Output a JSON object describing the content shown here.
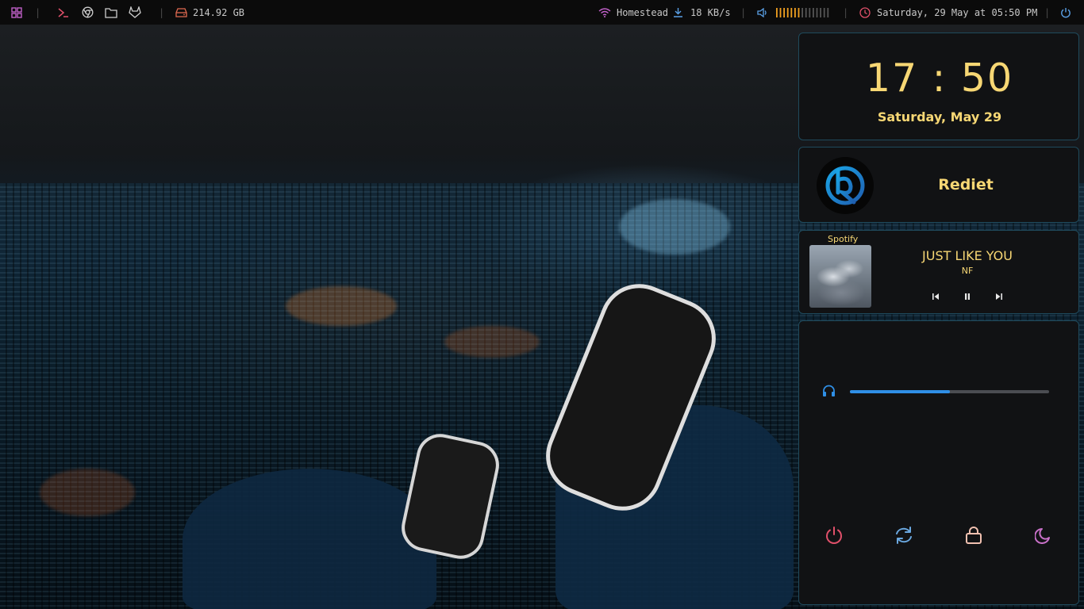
{
  "topbar": {
    "disk": "214.92 GB",
    "network_name": "Homestead",
    "network_speed": "18 KB/s",
    "volume_level": 0.45,
    "datetime": "Saturday, 29 May at 05:50 PM",
    "separator": "|"
  },
  "clock": {
    "time": "17 : 50",
    "date": "Saturday, May 29"
  },
  "profile": {
    "name": "Rediet"
  },
  "music": {
    "app": "Spotify",
    "title": "JUST LIKE YOU",
    "artist": "NF"
  },
  "volume": {
    "level": 0.5
  },
  "colors": {
    "accent": "#f7d774",
    "border": "#1f4a5c",
    "volume_fill": "#2f8fe6",
    "power": "#e0506a",
    "reboot": "#6ba8e0",
    "lock": "#f0c0b0",
    "sleep": "#c870c8"
  }
}
